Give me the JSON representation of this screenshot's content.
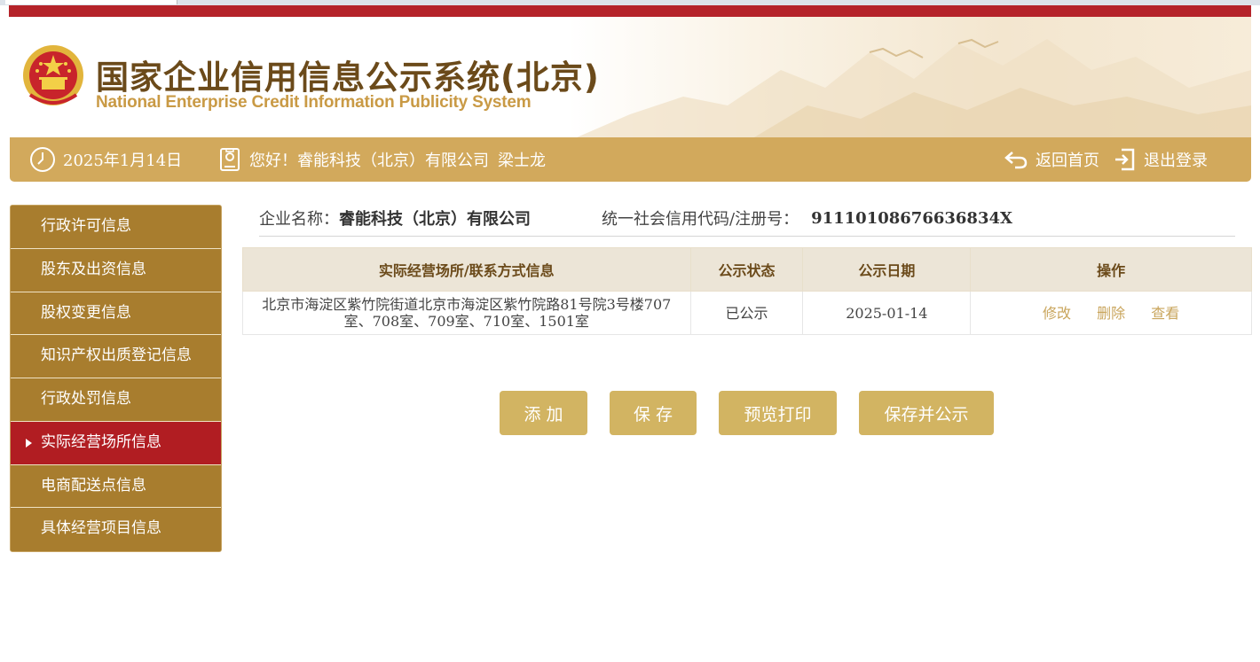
{
  "header": {
    "title_cn": "国家企业信用信息公示系统(北京)",
    "title_en": "National Enterprise Credit Information Publicity System"
  },
  "navbar": {
    "date": "2025年1月14日",
    "greeting": "您好！睿能科技（北京）有限公司",
    "user_name": "梁士龙",
    "home_label": "返回首页",
    "logout_label": "退出登录"
  },
  "sidebar": {
    "items": [
      {
        "label": "行政许可信息"
      },
      {
        "label": "股东及出资信息"
      },
      {
        "label": "股权变更信息"
      },
      {
        "label": "知识产权出质登记信息"
      },
      {
        "label": "行政处罚信息"
      },
      {
        "label": "实际经营场所信息"
      },
      {
        "label": "电商配送点信息"
      },
      {
        "label": "具体经营项目信息"
      }
    ],
    "active_index": 5
  },
  "company": {
    "name_label": "企业名称：",
    "name": "睿能科技（北京）有限公司",
    "code_label": "统一社会信用代码/注册号：",
    "code": "91110108676636834X"
  },
  "table": {
    "headers": [
      "实际经营场所/联系方式信息",
      "公示状态",
      "公示日期",
      "操作"
    ],
    "rows": [
      {
        "address": "北京市海淀区紫竹院街道北京市海淀区紫竹院路81号院3号楼707室、708室、709室、710室、1501室",
        "status": "已公示",
        "date": "2025-01-14",
        "actions": [
          "修改",
          "删除",
          "查看"
        ]
      }
    ]
  },
  "buttons": {
    "add": "添 加",
    "save": "保 存",
    "print": "预览打印",
    "publish": "保存并公示"
  },
  "colors": {
    "red_bar": "#b5232a",
    "nav_gold": "#d2a95c",
    "sidebar_brown": "#a87d2e",
    "sidebar_active": "#b11d22",
    "button_gold": "#d2b462",
    "link_gold": "#c9a55c"
  }
}
